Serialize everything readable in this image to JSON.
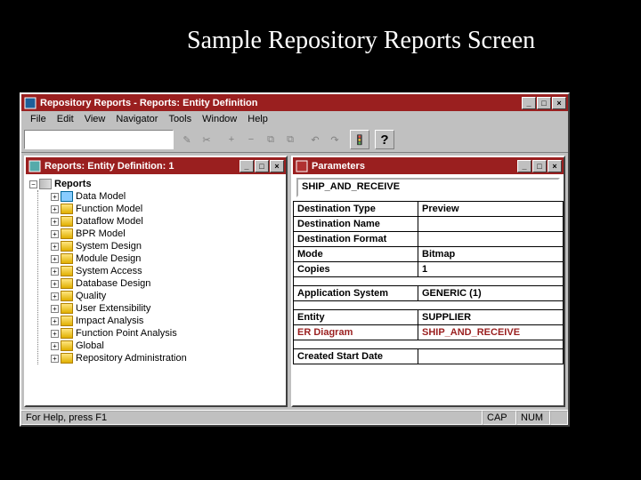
{
  "slide": {
    "title": "Sample Repository Reports Screen"
  },
  "main_window": {
    "title": "Repository Reports - Reports: Entity Definition",
    "menu": [
      "File",
      "Edit",
      "View",
      "Navigator",
      "Tools",
      "Window",
      "Help"
    ]
  },
  "toolbar": {
    "btn_stop": "✖",
    "btn_help": "?"
  },
  "tree_window": {
    "title": "Reports: Entity Definition: 1"
  },
  "tree": {
    "root": "Reports",
    "items": [
      "Data Model",
      "Function Model",
      "Dataflow Model",
      "BPR Model",
      "System Design",
      "Module Design",
      "System Access",
      "Database Design",
      "Quality",
      "User Extensibility",
      "Impact Analysis",
      "Function Point Analysis",
      "Global",
      "Repository Administration"
    ]
  },
  "param_window": {
    "title": "Parameters",
    "header_value": "SHIP_AND_RECEIVE"
  },
  "params": {
    "rows": [
      {
        "label": "Destination Type",
        "value": "Preview"
      },
      {
        "label": "Destination Name",
        "value": ""
      },
      {
        "label": "Destination Format",
        "value": ""
      },
      {
        "label": "Mode",
        "value": "Bitmap"
      },
      {
        "label": "Copies",
        "value": "1"
      }
    ],
    "section2": [
      {
        "label": "Application System",
        "value": "GENERIC (1)"
      }
    ],
    "section3": [
      {
        "label": "Entity",
        "value": "SUPPLIER",
        "hl": false
      },
      {
        "label": "ER Diagram",
        "value": "SHIP_AND_RECEIVE",
        "hl": true
      }
    ],
    "section4": [
      {
        "label": "Created Start Date",
        "value": ""
      }
    ]
  },
  "status": {
    "help": "For Help, press F1",
    "caps": "CAP",
    "num": "NUM"
  }
}
